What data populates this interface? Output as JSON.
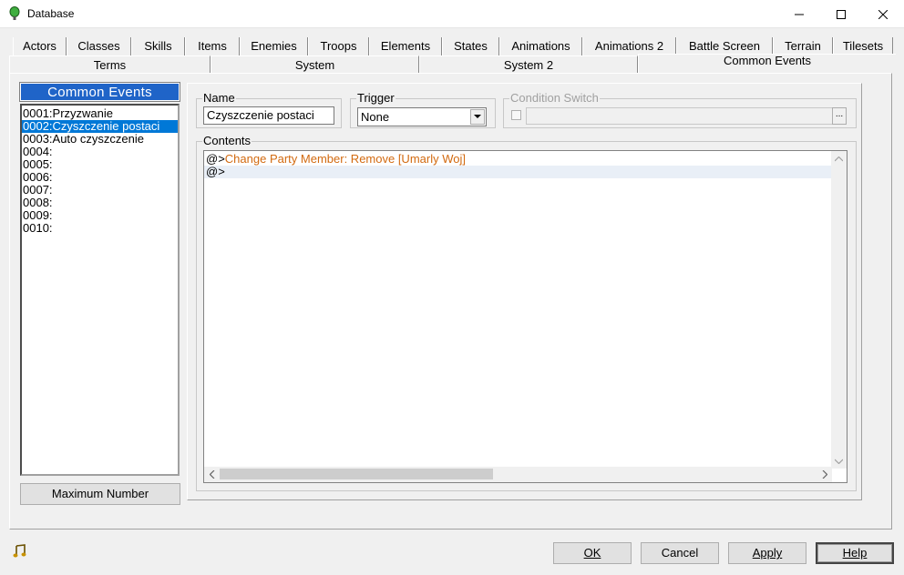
{
  "window": {
    "title": "Database"
  },
  "tabs_top": [
    "Actors",
    "Classes",
    "Skills",
    "Items",
    "Enemies",
    "Troops",
    "Elements",
    "States",
    "Animations",
    "Animations 2",
    "Battle Screen",
    "Terrain",
    "Tilesets"
  ],
  "tabs_bottom": [
    "Terms",
    "System",
    "System 2",
    "Common Events"
  ],
  "active_tab": "Common Events",
  "events": {
    "header": "Common Events",
    "items": [
      "0001:Przyzwanie",
      "0002:Czyszczenie postaci",
      "0003:Auto czyszczenie",
      "0004:",
      "0005:",
      "0006:",
      "0007:",
      "0008:",
      "0009:",
      "0010:"
    ],
    "selected_index": 1,
    "max_button": "Maximum Number"
  },
  "editor": {
    "name_label": "Name",
    "name_value": "Czyszczenie postaci",
    "trigger_label": "Trigger",
    "trigger_value": "None",
    "condition_label": "Condition Switch",
    "condition_button": "...",
    "contents_label": "Contents",
    "lines": [
      {
        "prefix": "@>",
        "command": "Change Party Member: Remove [Umarly Woj]"
      },
      {
        "prefix": "@>",
        "command": ""
      }
    ]
  },
  "buttons": {
    "ok": "OK",
    "cancel": "Cancel",
    "apply": "Apply",
    "help": "Help"
  },
  "colors": {
    "accent": "#0078d7",
    "header": "#1f64c8",
    "command": "#d26a10"
  }
}
